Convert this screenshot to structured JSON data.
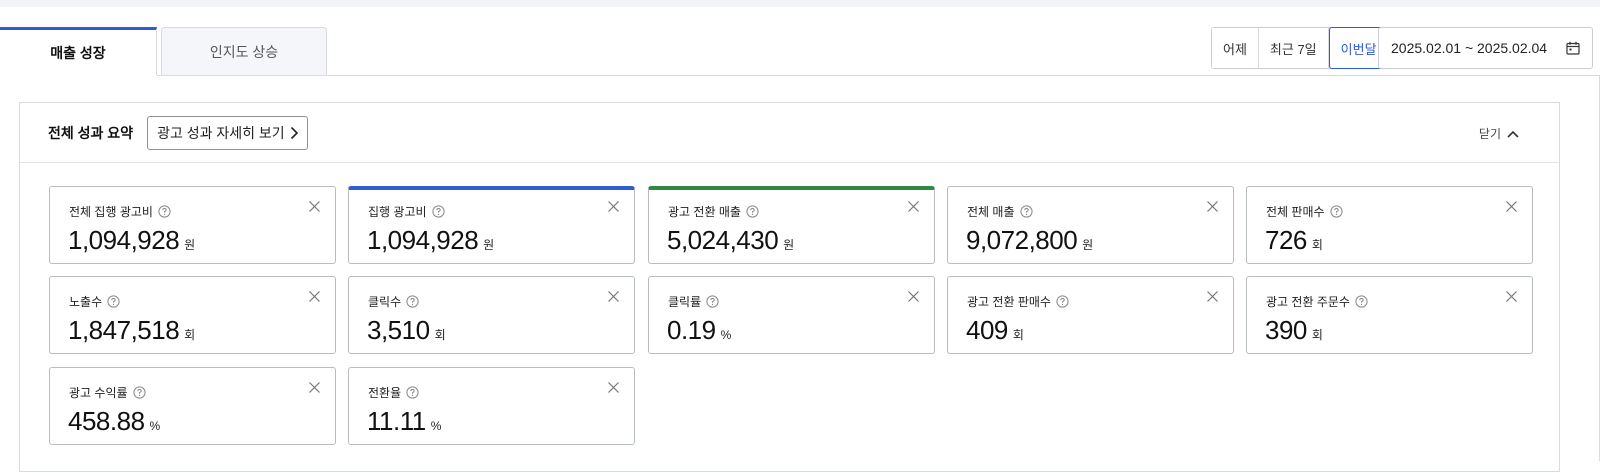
{
  "tabs": [
    {
      "label": "매출 성장",
      "active": true
    },
    {
      "label": "인지도 상승",
      "active": false
    }
  ],
  "date_presets": [
    {
      "label": "어제",
      "selected": false
    },
    {
      "label": "최근 7일",
      "selected": false
    },
    {
      "label": "이번달",
      "selected": true
    }
  ],
  "date_range": "2025.02.01 ~ 2025.02.04",
  "summary": {
    "title": "전체 성과 요약",
    "detail_button": "광고 성과 자세히 보기",
    "close_label": "닫기"
  },
  "colors": {
    "accent_blue": "#2f5bd3",
    "accent_green": "#2e8b3f"
  },
  "metrics": [
    {
      "label": "전체 집행 광고비",
      "value": "1,094,928",
      "unit": "원"
    },
    {
      "label": "집행 광고비",
      "value": "1,094,928",
      "unit": "원"
    },
    {
      "label": "광고 전환 매출",
      "value": "5,024,430",
      "unit": "원"
    },
    {
      "label": "전체 매출",
      "value": "9,072,800",
      "unit": "원"
    },
    {
      "label": "전체 판매수",
      "value": "726",
      "unit": "회"
    },
    {
      "label": "노출수",
      "value": "1,847,518",
      "unit": "회"
    },
    {
      "label": "클릭수",
      "value": "3,510",
      "unit": "회"
    },
    {
      "label": "클릭률",
      "value": "0.19",
      "unit": "%"
    },
    {
      "label": "광고 전환 판매수",
      "value": "409",
      "unit": "회"
    },
    {
      "label": "광고 전환 주문수",
      "value": "390",
      "unit": "회"
    },
    {
      "label": "광고 수익률",
      "value": "458.88",
      "unit": "%"
    },
    {
      "label": "전환율",
      "value": "11.11",
      "unit": "%"
    }
  ]
}
